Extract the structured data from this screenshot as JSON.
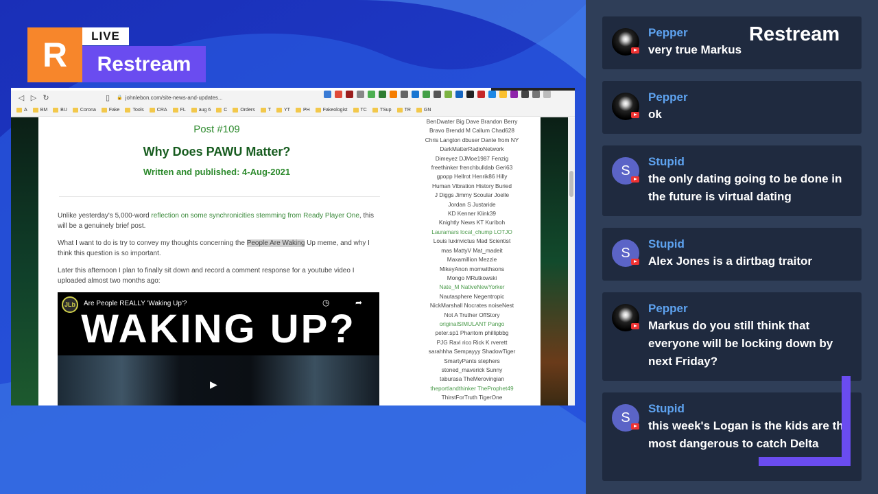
{
  "overlay": {
    "logo_letter": "R",
    "live_label": "LIVE",
    "brand": "Restream",
    "chat_brand": "Restream",
    "colors": {
      "orange": "#f7862b",
      "purple": "#6a4cf0",
      "blue_bg": "#1b3fc6",
      "chat_name": "#5ea3f0"
    }
  },
  "browser": {
    "url": "johnlebon.com/site-news-and-updates...",
    "bookmarks": [
      "A",
      "BM",
      "BU",
      "Corona",
      "Fake",
      "Tools",
      "CRA",
      "FL",
      "aug 6",
      "C",
      "Orders",
      "T",
      "YT",
      "PH",
      "Fakeologist",
      "TC",
      "TSup",
      "TR",
      "GN"
    ]
  },
  "post": {
    "number": "Post #109",
    "title": "Why Does PAWU Matter?",
    "date": "Written and published: 4-Aug-2021",
    "p1_a": "Unlike yesterday's 5,000-word ",
    "p1_link": "reflection on some synchronicities stemming from Ready Player One",
    "p1_b": ", this will be a genuinely brief post.",
    "p2_a": "What I want to do is try to convey my thoughts concerning the ",
    "p2_hl": "People Are Waking",
    "p2_b": " Up meme, and why I think this question is so important.",
    "p3": "Later this afternoon I plan to finally sit down and record a comment response for a youtube video I uploaded almost two months ago:",
    "video": {
      "channel": "JLb",
      "title": "Are People REALLY 'Waking Up'?",
      "big_text": "WAKING UP?"
    }
  },
  "sidebar_names": [
    "BenDwater  Big Dave  Brandon Berry",
    "Bravo  Brendd M  Callum  Chad628",
    "Chris Langton  dbuser  Dante from NY",
    "DarkMatterRadioNetwork",
    "Dimeyez  DJMoe1987  Fenzig",
    "freethinker  frenchbulldab  Geri63",
    "gpopp  Hellrot  Henrik86  Hilly",
    "Human Vibration  History Buried",
    "J Diggs  Jimmy Scoular  Joelle",
    "Jordan S  Justaride",
    "KD  Kenner  Klink39",
    "Knightly News  KT  Kuriboh",
    "Lauramars  local_chump  LOTJO",
    "Louis  luxinvictus  Mad Scientist",
    "mas  MattyV  Mat_madeit",
    "Maxamillion  Mezzie",
    "MikeyAnon  momwithsons",
    "Mongo  MRutkowski",
    "Nate_M  NativeNewYorker",
    "Nautasphere  Negentropic",
    "NickMarshall  Nocrates  noiseNest",
    "Not A Truther  OffStory",
    "originalSIMULANT  Pango",
    "peter.sp1  Phantom  phillipbbg",
    "PJG  Ravi  rico  Rick K  rverett",
    "sarahhha  Sempayyy  ShadowTiger",
    "SmartyPants  stephers",
    "stoned_maverick  Sunny",
    "taburasa  TheMerovingian",
    "theportlandthinker  TheProphet49",
    "ThirstForTruth  TigerOne"
  ],
  "chat": [
    {
      "name": "Pepper",
      "avatar": "pepper",
      "message": "very true Markus"
    },
    {
      "name": "Pepper",
      "avatar": "pepper",
      "message": "ok"
    },
    {
      "name": "Stupid",
      "avatar": "S",
      "message": "the only dating going to be done in the future is virtual dating"
    },
    {
      "name": "Stupid",
      "avatar": "S",
      "message": "Alex Jones is a dirtbag traitor"
    },
    {
      "name": "Pepper",
      "avatar": "pepper",
      "message": "Markus do you still think that everyone will be locking down by next Friday?"
    },
    {
      "name": "Stupid",
      "avatar": "S",
      "message": "this week's Logan is the kids are the most dangerous to catch Delta"
    }
  ]
}
